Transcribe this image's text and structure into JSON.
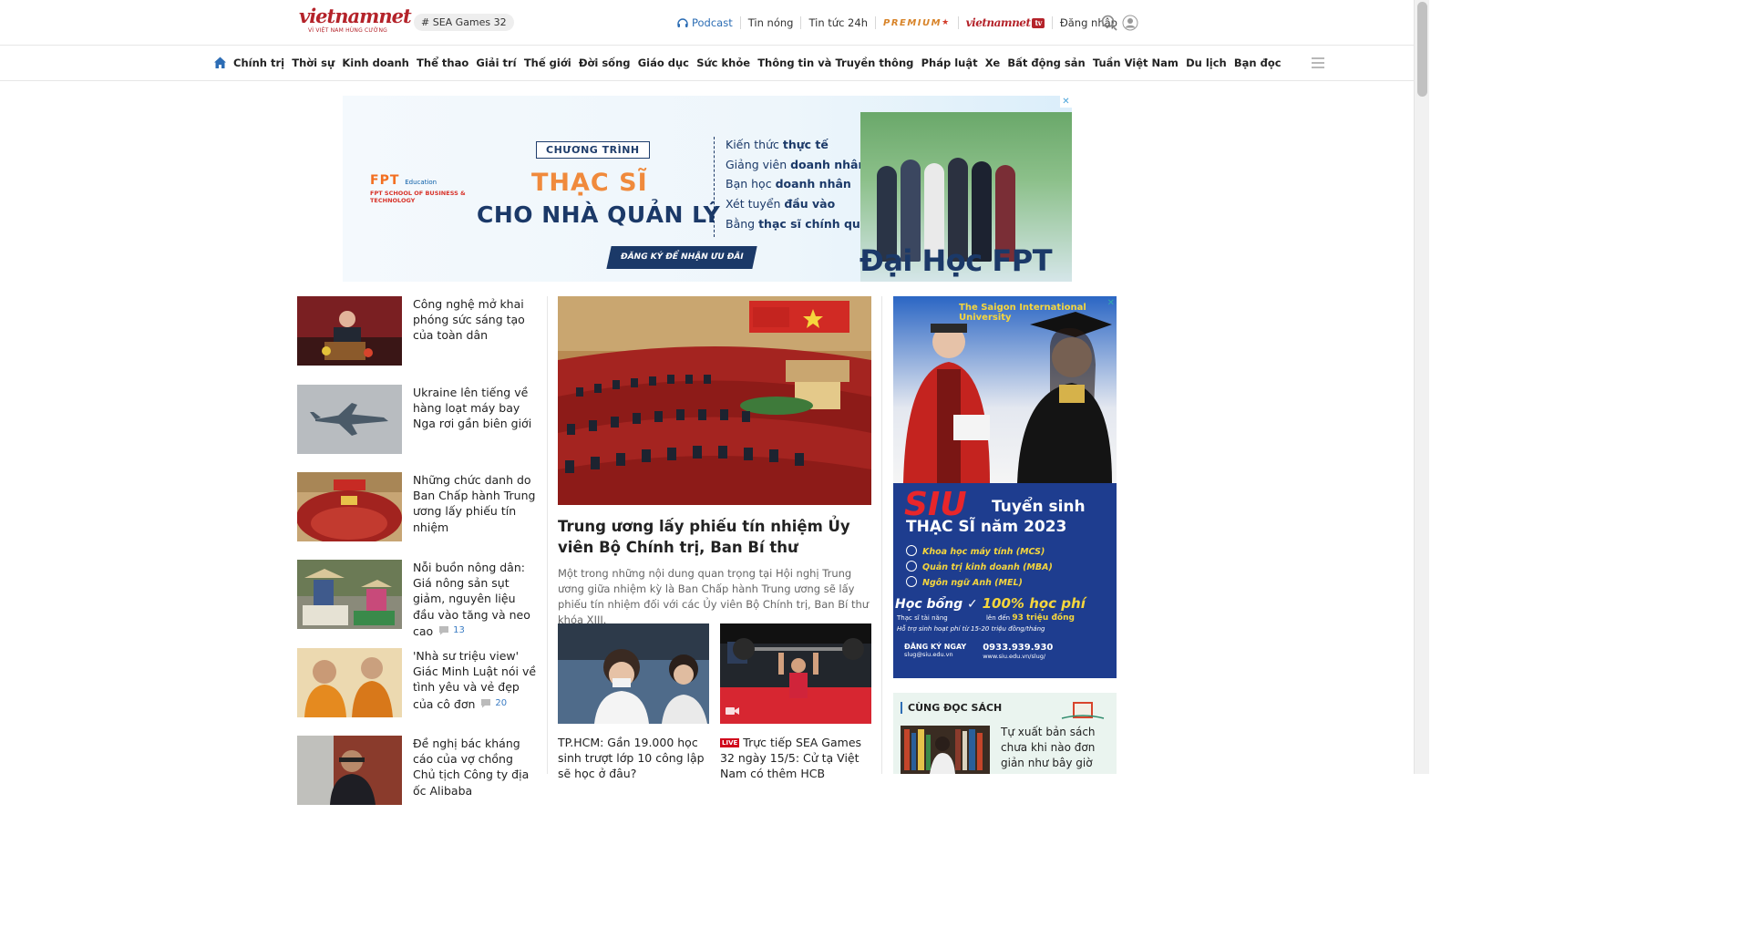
{
  "header": {
    "logo_text": "vietnamnet",
    "logo_tagline": "VÌ VIỆT NAM HÙNG CƯỜNG",
    "hashtag": "# SEA Games 32",
    "links": {
      "podcast": "Podcast",
      "tin_nong": "Tin nóng",
      "tin_tuc_24h": "Tin tức 24h",
      "premium": "PREMIUM",
      "vntv": "vietnamnet",
      "vntv_badge": "tv",
      "login": "Đăng nhập"
    },
    "accent_color": "#b4232a"
  },
  "nav": {
    "items": [
      "Chính trị",
      "Thời sự",
      "Kinh doanh",
      "Thể thao",
      "Giải trí",
      "Thế giới",
      "Đời sống",
      "Giáo dục",
      "Sức khỏe",
      "Thông tin và Truyền thông",
      "Pháp luật",
      "Xe",
      "Bất động sản",
      "Tuần Việt Nam",
      "Du lịch",
      "Bạn đọc"
    ]
  },
  "banner_ad": {
    "logo_fpt": "FPT",
    "logo_education": "Education",
    "logo_school": "FPT SCHOOL OF BUSINESS & TECHNOLOGY",
    "program": "CHƯƠNG TRÌNH",
    "headline_1": "THẠC SĨ",
    "headline_2": "CHO NHÀ QUẢN LÝ",
    "cta": "ĐĂNG KÝ ĐỂ NHẬN ƯU ĐÃI",
    "features": [
      {
        "pre": "Kiến thức ",
        "bold": "thực tế"
      },
      {
        "pre": "Giảng viên ",
        "bold": "doanh nhân"
      },
      {
        "pre": "Bạn học ",
        "bold": "doanh nhân"
      },
      {
        "pre": "Xét tuyển ",
        "bold": "đầu vào"
      },
      {
        "pre": "Bằng ",
        "bold": "thạc sĩ chính quy"
      }
    ],
    "brand": "Đại Học FPT",
    "close": "✕"
  },
  "side_news": [
    {
      "title": "Công nghệ mở khai phóng sức sáng tạo của toàn dân",
      "comments": ""
    },
    {
      "title": "Ukraine lên tiếng về hàng loạt máy bay Nga rơi gần biên giới",
      "comments": ""
    },
    {
      "title": "Những chức danh do Ban Chấp hành Trung ương lấy phiếu tín nhiệm",
      "comments": ""
    },
    {
      "title": "Nỗi buồn nông dân: Giá nông sản sụt giảm, nguyên liệu đầu vào tăng và neo cao",
      "comments": "13"
    },
    {
      "title": "'Nhà sư triệu view' Giác Minh Luật nói về tình yêu và vẻ đẹp của cô đơn",
      "comments": "20"
    },
    {
      "title": "Đề nghị bác kháng cáo của vợ chồng Chủ tịch Công ty địa ốc Alibaba",
      "comments": ""
    }
  ],
  "main_story": {
    "title": "Trung ương lấy phiếu tín nhiệm Ủy viên Bộ Chính trị, Ban Bí thư",
    "summary": "Một trong những nội dung quan trọng tại Hội nghị Trung ương giữa nhiệm kỳ là Ban Chấp hành Trung ương sẽ lấy phiếu tín nhiệm đối với các Ủy viên Bộ Chính trị, Ban Bí thư khóa XIII."
  },
  "sub_stories": [
    {
      "title": "TP.HCM: Gần 19.000 học sinh trượt lớp 10 công lập sẽ học ở đâu?",
      "live": ""
    },
    {
      "title": "Trực tiếp SEA Games 32 ngày 15/5: Cử tạ Việt Nam có thêm HCB",
      "live": "LIVE"
    }
  ],
  "right_ad": {
    "university": "The Saigon International University",
    "siu": "SIU",
    "tuyen_sinh": "Tuyển sinh",
    "thac_si": "THẠC SĨ năm 2023",
    "programs": [
      "Khoa học máy tính (MCS)",
      "Quản trị kinh doanh (MBA)",
      "Ngôn ngữ Anh (MEL)"
    ],
    "hoc_bong": "Học bổng",
    "hoc_bong_value": "100% học phí",
    "thac_si_tai_nang": "Thạc sĩ tài năng",
    "len_den": "lên đến",
    "trieu_dong": "93 triệu đồng",
    "ho_tro": "Hỗ trợ sinh hoạt phí từ 15-20 triệu đồng/tháng",
    "dang_ky": "ĐĂNG KÝ NGAY",
    "email": "slug@siu.edu.vn",
    "phone": "0933.939.930",
    "website": "www.siu.edu.vn/slug/"
  },
  "reading_box": {
    "title": "CÙNG ĐỌC SÁCH",
    "article": "Tự xuất bản sách chưa khi nào đơn giản như bây giờ"
  }
}
